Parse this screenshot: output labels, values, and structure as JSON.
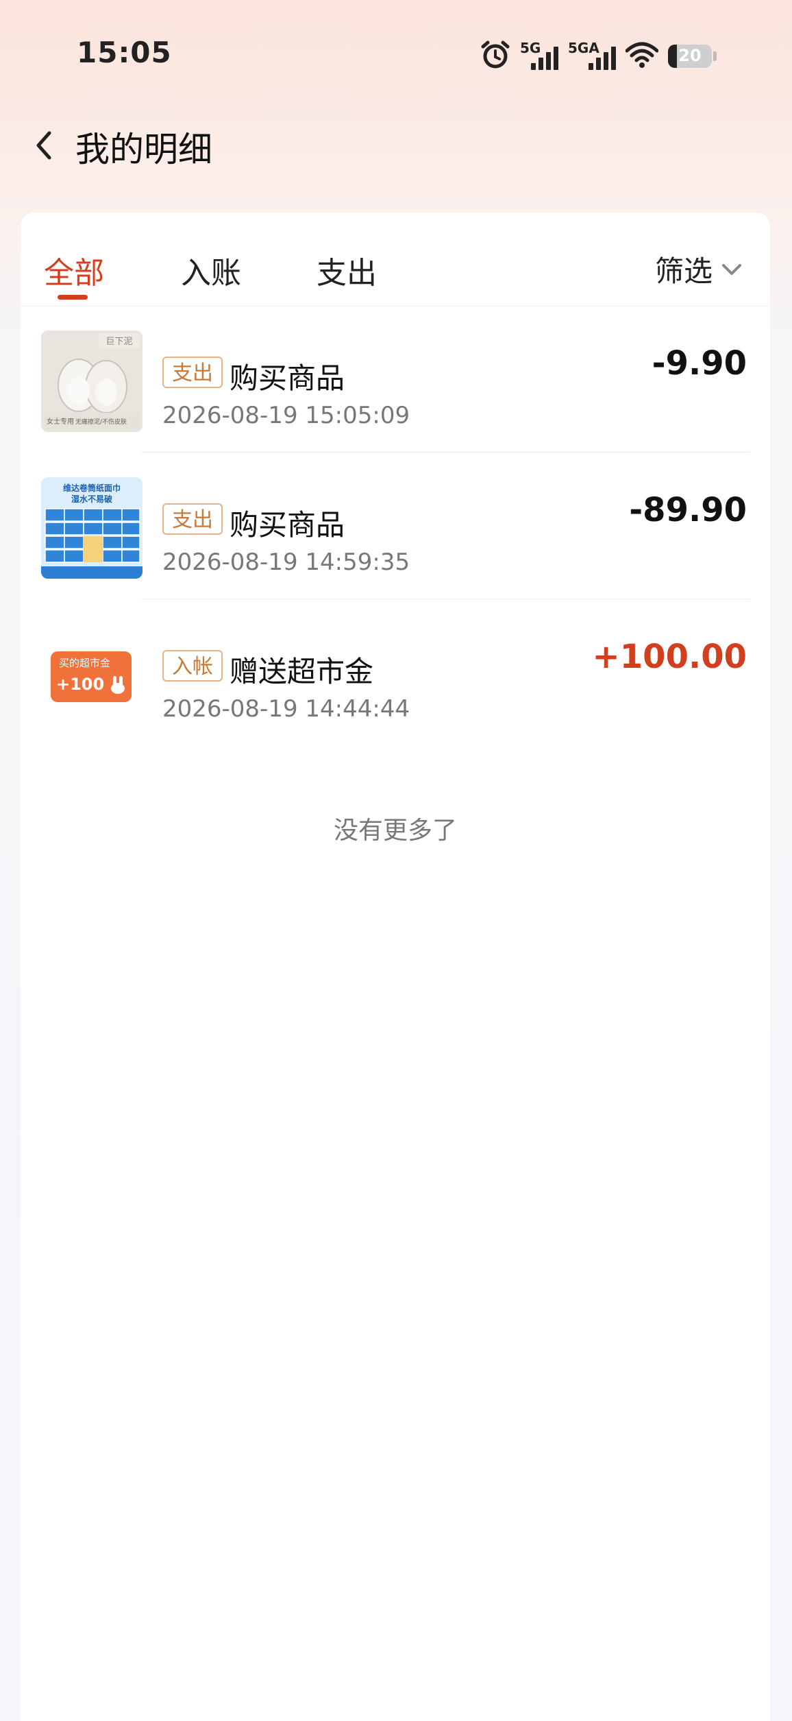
{
  "status_bar": {
    "time": "15:05",
    "signal_1": "5G",
    "signal_2": "5GA",
    "battery": "20",
    "battery_level": 0.2
  },
  "header": {
    "back_icon": "chevron-left-icon",
    "title": "我的明细"
  },
  "tabs": [
    {
      "label": "全部",
      "active": true
    },
    {
      "label": "入账",
      "active": false
    },
    {
      "label": "支出",
      "active": false
    }
  ],
  "filter": {
    "label": "筛选",
    "icon": "chevron-down-icon"
  },
  "transactions": [
    {
      "tag": "支出",
      "name": "购买商品",
      "time": "2026-08-19 15:05:09",
      "amount": "-9.90",
      "type": "expense"
    },
    {
      "tag": "支出",
      "name": "购买商品",
      "time": "2026-08-19 14:59:35",
      "amount": "-89.90",
      "type": "expense"
    },
    {
      "tag": "入帐",
      "name": "赠送超市金",
      "time": "2026-08-19 14:44:44",
      "amount": "+100.00",
      "type": "income"
    }
  ],
  "thumb_texts": {
    "t1_brand": "巨下泥",
    "t1_label1": "女士专用",
    "t1_label2": "无痛擦泥/不伤皮肤",
    "t2_line1": "维达卷筒纸面巾",
    "t2_line2": "湿水不易破",
    "t3_label": "买的超市金",
    "t3_value": "+100"
  },
  "end_text": "没有更多了",
  "colors": {
    "accent": "#d23f1f",
    "tag_border": "#e3b38b",
    "tag_text": "#c87a38"
  }
}
